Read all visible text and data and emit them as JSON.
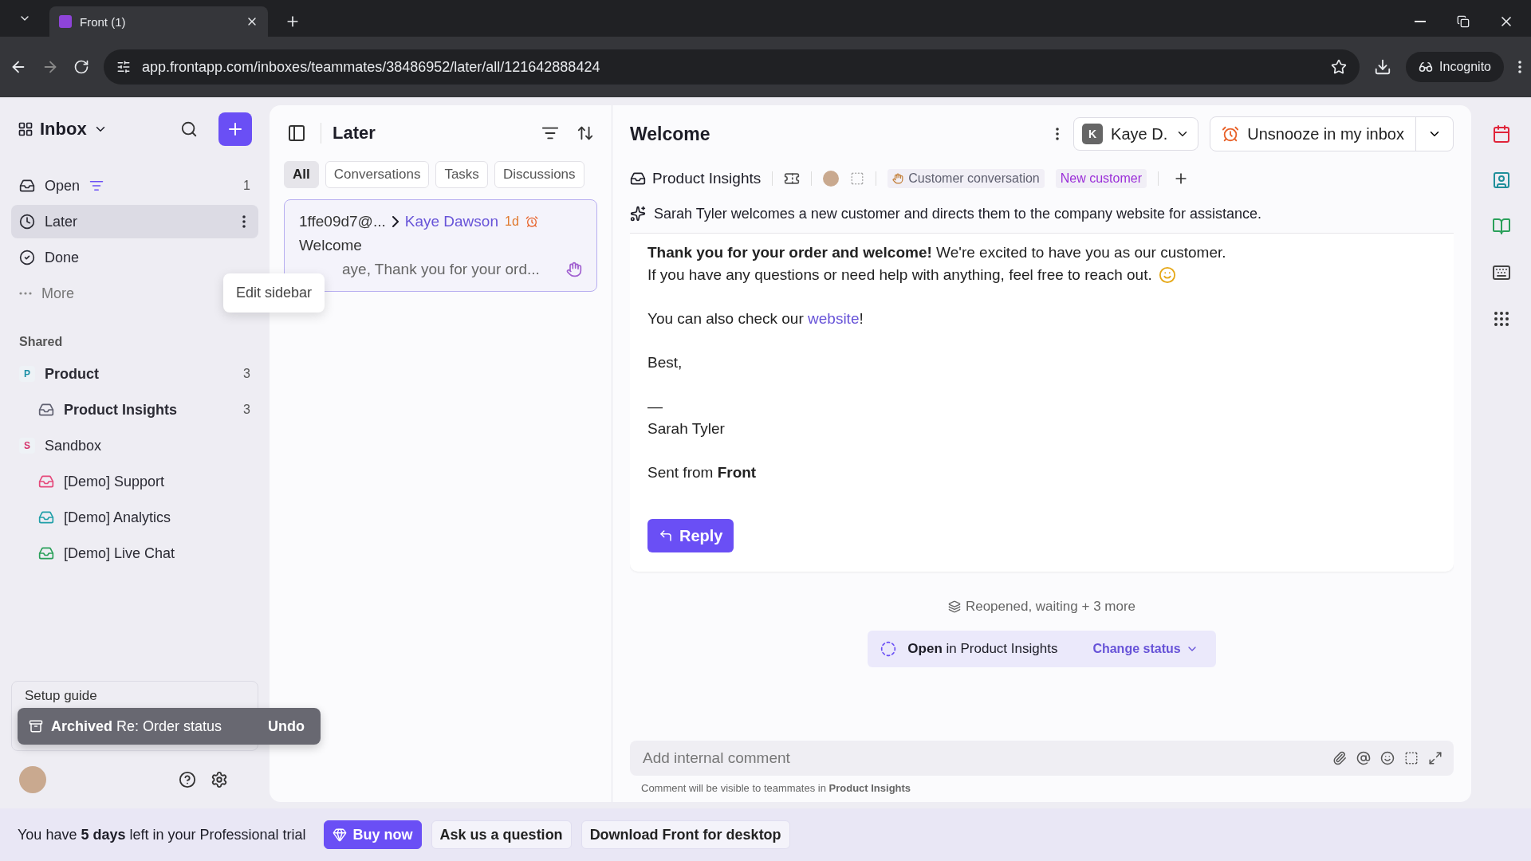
{
  "browser": {
    "tabs": [
      {
        "title": "Front (1)",
        "selected": true
      }
    ],
    "url": "app.frontapp.com/inboxes/teammates/38486952/later/all/121642888424",
    "profile": "Incognito"
  },
  "sidebar": {
    "title": "Inbox",
    "items": [
      {
        "label": "Open",
        "count": "1",
        "selected": false,
        "kind": "open"
      },
      {
        "label": "Later",
        "selected": true,
        "kind": "later"
      },
      {
        "label": "Done",
        "selected": false,
        "kind": "done"
      },
      {
        "label": "More",
        "selected": false,
        "kind": "more"
      }
    ],
    "shared_heading": "Shared",
    "groups": [
      {
        "letter": "P",
        "label": "Product",
        "count": "3",
        "unread": true,
        "color": "#1b8fa6",
        "children": [
          {
            "label": "Product Insights",
            "count": "3",
            "unread": true,
            "color": "#5f6070"
          }
        ]
      },
      {
        "letter": "S",
        "label": "Sandbox",
        "unread": false,
        "color": "#d6336c",
        "children": [
          {
            "label": "[Demo] Support",
            "unread": false,
            "color": "#e5487a"
          },
          {
            "label": "[Demo] Analytics",
            "unread": false,
            "color": "#1f9fa8"
          },
          {
            "label": "[Demo] Live Chat",
            "unread": false,
            "color": "#2aa05a"
          }
        ]
      }
    ],
    "setup_guide": "Setup guide",
    "tooltip": "Edit sidebar",
    "toast": {
      "title": "Archived",
      "text": "Re: Order status",
      "action": "Undo"
    }
  },
  "list": {
    "title": "Later",
    "filters": [
      {
        "label": "All",
        "selected": true
      },
      {
        "label": "Conversations",
        "selected": false
      },
      {
        "label": "Tasks",
        "selected": false
      },
      {
        "label": "Discussions",
        "selected": false
      }
    ],
    "conversations": [
      {
        "from": "1ffe09d7@...",
        "to": "Kaye Dawson",
        "time": "1d",
        "subject": "Welcome",
        "preview": "aye, Thank you for your ord..."
      }
    ]
  },
  "conversation": {
    "title": "Welcome",
    "assignee": {
      "initial": "K",
      "name": "Kaye D."
    },
    "action": "Unsnooze in my inbox",
    "inbox": "Product Insights",
    "tags": [
      {
        "label": "Customer conversation",
        "color": "#5f6070"
      },
      {
        "label": "New customer",
        "color": "#9b2fd8"
      }
    ],
    "summary": "Sarah Tyler welcomes a new customer and directs them to the company website for assistance.",
    "message": {
      "lines": [
        "**Thank you for your order and welcome!** We're excited to have you as our customer.",
        "If you have any questions or need help with anything, feel free to reach out."
      ],
      "link_before": "You can also check our ",
      "link": "website",
      "link_after": "!",
      "closing": "Best,",
      "dash": "—",
      "signature": "Sarah Tyler",
      "sent_from": "Sent from **Front**",
      "reply": "Reply"
    },
    "status_summary": "Reopened, waiting + 3 more",
    "status": "**Open** in Product Insights",
    "change_status": "Change status",
    "comment": {
      "placeholder": "Add internal comment",
      "note": "Comment will be visible to teammates in **Product Insights**"
    }
  },
  "banner": {
    "text": "You have **5 days** left in your Professional trial",
    "buttons": [
      "Buy now",
      "Ask us a question",
      "Download Front for desktop"
    ]
  }
}
